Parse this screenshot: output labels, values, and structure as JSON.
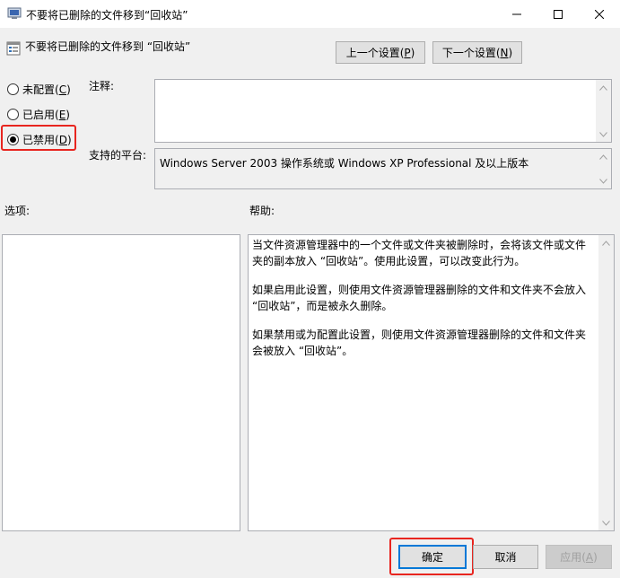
{
  "window": {
    "title": "不要将已删除的文件移到“回收站”",
    "minimize_icon": "minimize-icon",
    "maximize_icon": "maximize-icon",
    "close_icon": "close-icon"
  },
  "header": {
    "policy_name": "不要将已删除的文件移到 “回收站”",
    "prev_setting": {
      "text": "上一个设置(",
      "key": "P",
      "end": ")"
    },
    "next_setting": {
      "text": "下一个设置(",
      "key": "N",
      "end": ")"
    }
  },
  "state_options": [
    {
      "text": "未配置(",
      "key": "C",
      "end": ")",
      "selected": false
    },
    {
      "text": "已启用(",
      "key": "E",
      "end": ")",
      "selected": false
    },
    {
      "text": "已禁用(",
      "key": "D",
      "end": ")",
      "selected": true
    }
  ],
  "comment": {
    "label": "注释:",
    "value": ""
  },
  "supported_on": {
    "label": "支持的平台:",
    "value": "Windows Server 2003 操作系统或 Windows XP Professional 及以上版本"
  },
  "options": {
    "label": "选项:"
  },
  "help": {
    "label": "帮助:",
    "paragraphs": [
      "当文件资源管理器中的一个文件或文件夹被删除时，会将该文件或文件夹的副本放入 “回收站”。使用此设置，可以改变此行为。",
      "如果启用此设置，则使用文件资源管理器删除的文件和文件夹不会放入 “回收站”，而是被永久删除。",
      "如果禁用或为配置此设置，则使用文件资源管理器删除的文件和文件夹会被放入 “回收站”。"
    ]
  },
  "footer": {
    "ok": "确定",
    "cancel": "取消",
    "apply": {
      "text": "应用(",
      "key": "A",
      "end": ")"
    }
  },
  "colors": {
    "highlight": "#e8251f",
    "focus": "#0078d7"
  }
}
